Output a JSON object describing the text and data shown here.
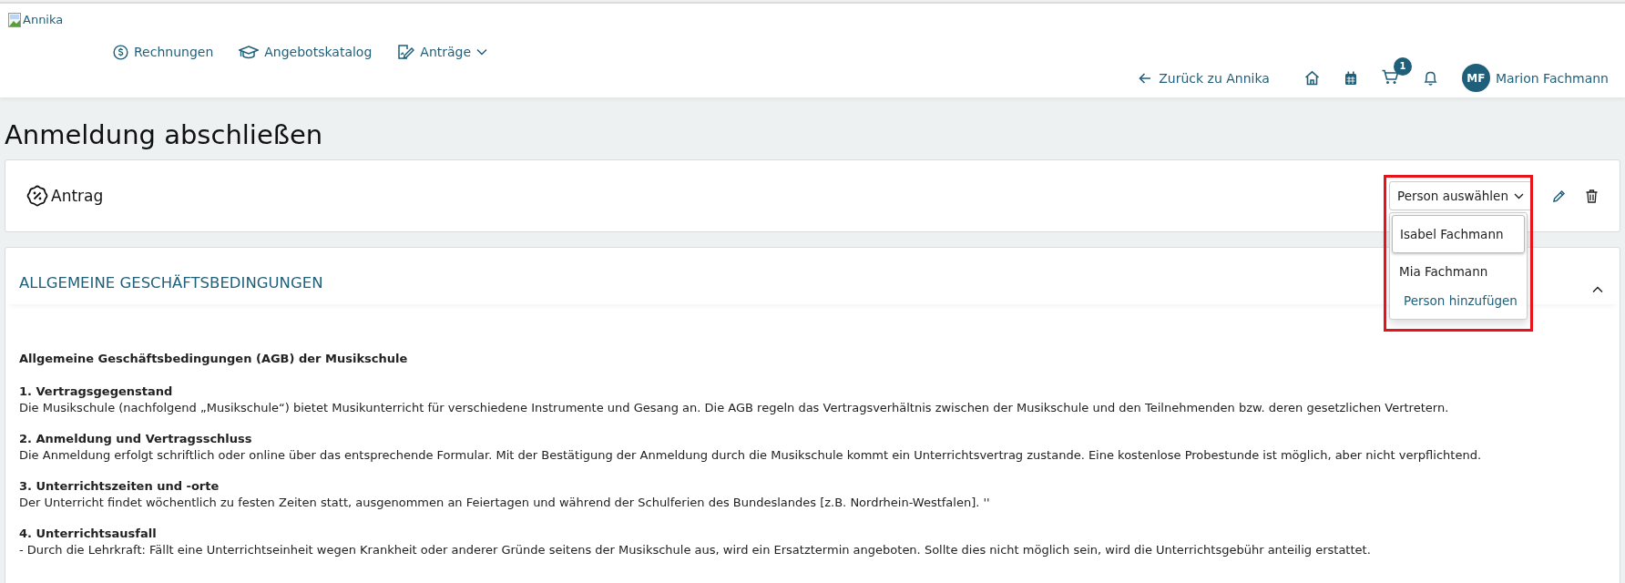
{
  "header": {
    "logo_alt": "Annika",
    "nav": [
      {
        "label": "Rechnungen",
        "kind": "invoices",
        "has_menu": false
      },
      {
        "label": "Angebotskatalog",
        "kind": "catalog",
        "has_menu": false
      },
      {
        "label": "Anträge",
        "kind": "applications",
        "has_menu": true
      }
    ],
    "back_link": "Zurück zu Annika",
    "cart_count": "1",
    "user": {
      "initials": "MF",
      "name": "Marion Fachmann"
    }
  },
  "page_title": "Anmeldung abschließen",
  "application_card": {
    "title": "Antrag",
    "person_select": {
      "label": "Person auswählen",
      "expanded": true,
      "options": [
        {
          "label": "Isabel Fachmann",
          "kind": "person",
          "selected": true
        },
        {
          "label": "Mia Fachmann",
          "kind": "person",
          "selected": false
        },
        {
          "label": "Person hinzufügen",
          "kind": "action",
          "selected": false
        }
      ]
    }
  },
  "terms": {
    "title": "ALLGEMEINE GESCHÄFTSBEDINGUNGEN",
    "expanded": true,
    "heading": "Allgemeine Geschäftsbedingungen (AGB) der Musikschule",
    "sections": [
      {
        "title": "1. Vertragsgegenstand",
        "lines": [
          "Die Musikschule (nachfolgend „Musikschule“) bietet Musikunterricht für verschiedene Instrumente und Gesang an. Die AGB regeln das Vertragsverhältnis zwischen der Musikschule und den Teilnehmenden bzw. deren gesetzlichen Vertretern."
        ]
      },
      {
        "title": "2. Anmeldung und Vertragsschluss",
        "lines": [
          "Die Anmeldung erfolgt schriftlich oder online über das entsprechende Formular. Mit der Bestätigung der Anmeldung durch die Musikschule kommt ein Unterrichtsvertrag zustande. Eine kostenlose Probestunde ist möglich, aber nicht verpflichtend."
        ]
      },
      {
        "title": "3. Unterrichtszeiten und -orte",
        "lines": [
          "Der Unterricht findet wöchentlich zu festen Zeiten statt, ausgenommen an Feiertagen und während der Schulferien des Bundeslandes [z.B. Nordrhein-Westfalen]. ''"
        ]
      },
      {
        "title": "4. Unterrichtsausfall",
        "lines": [
          "- Durch die Lehrkraft: Fällt eine Unterrichtseinheit wegen Krankheit oder anderer Gründe seitens der Musikschule aus, wird ein Ersatztermin angeboten. Sollte dies nicht möglich sein, wird die Unterrichtsgebühr anteilig erstattet."
        ]
      }
    ]
  }
}
